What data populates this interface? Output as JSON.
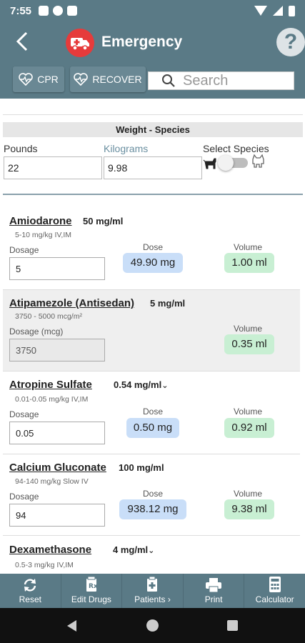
{
  "status": {
    "time": "7:55"
  },
  "header": {
    "title": "Emergency",
    "help_label": "?"
  },
  "buttons": {
    "cpr": "CPR",
    "recover": "RECOVER"
  },
  "search": {
    "placeholder": "Search"
  },
  "weight": {
    "heading": "Weight - Species",
    "pounds_label": "Pounds",
    "kilograms_label": "Kilograms",
    "species_label": "Select Species",
    "pounds_value": "22",
    "kilograms_value": "9.98",
    "species_toggle_on": false
  },
  "drugs": [
    {
      "name": "Amiodarone",
      "concentration": "50 mg/ml",
      "range": "5-10 mg/kg IV,IM",
      "dosage_label": "Dosage",
      "dosage_value": "5",
      "dose_label": "Dose",
      "dose": "49.90 mg",
      "volume_label": "Volume",
      "volume": "1.00 ml"
    },
    {
      "name": "Atipamezole (Antisedan)",
      "concentration": "5 mg/ml",
      "range": "3750 - 5000 mcg/m²",
      "dosage_label": "Dosage (mcg)",
      "dosage_value": "3750",
      "volume_label": "Volume",
      "volume": "0.35 ml"
    },
    {
      "name": "Atropine Sulfate",
      "concentration": "0.54 mg/ml",
      "range": "0.01-0.05 mg/kg IV,IM",
      "dosage_label": "Dosage",
      "dosage_value": "0.05",
      "dose_label": "Dose",
      "dose": "0.50 mg",
      "volume_label": "Volume",
      "volume": "0.92 ml"
    },
    {
      "name": "Calcium Gluconate",
      "concentration": "100 mg/ml",
      "range": "94-140 mg/kg Slow IV",
      "dosage_label": "Dosage",
      "dosage_value": "94",
      "dose_label": "Dose",
      "dose": "938.12 mg",
      "volume_label": "Volume",
      "volume": "9.38 ml"
    },
    {
      "name": "Dexamethasone",
      "concentration": "4 mg/ml",
      "range": "0.5-3 mg/kg IV,IM"
    }
  ],
  "toolbar": {
    "reset": "Reset",
    "edit_drugs": "Edit Drugs",
    "patients": "Patients ›",
    "print": "Print",
    "calculator": "Calculator"
  },
  "colors": {
    "header": "#5a7a86",
    "dose_pill": "#c9def8",
    "volume_pill": "#c8efd3",
    "logo": "#e63b3b"
  }
}
